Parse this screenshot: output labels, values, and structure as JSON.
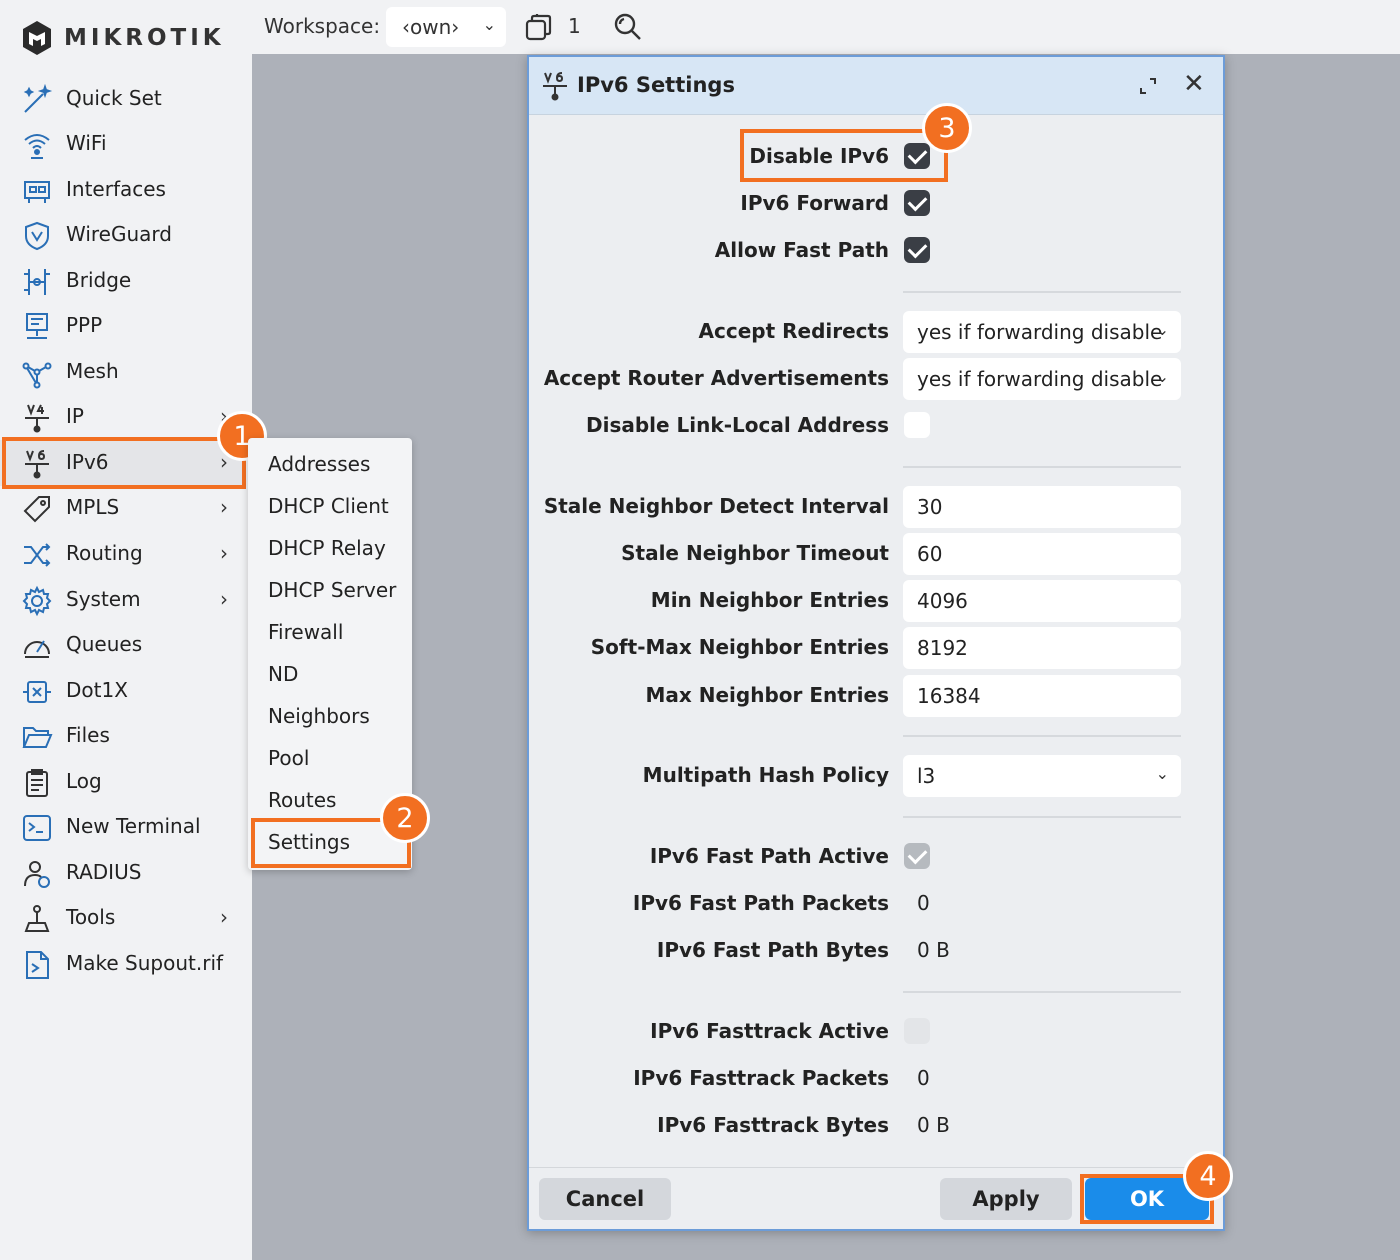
{
  "brand": {
    "name": "MIKROTIK"
  },
  "topbar": {
    "workspace_label": "Workspace:",
    "workspace_value": "‹own›",
    "window_count": "1"
  },
  "sidebar": {
    "items": [
      {
        "label": "Quick Set",
        "icon": "wand-icon",
        "submenu": false
      },
      {
        "label": "WiFi",
        "icon": "wifi-icon",
        "submenu": false
      },
      {
        "label": "Interfaces",
        "icon": "interfaces-icon",
        "submenu": false
      },
      {
        "label": "WireGuard",
        "icon": "shield-icon",
        "submenu": false
      },
      {
        "label": "Bridge",
        "icon": "bridge-icon",
        "submenu": false
      },
      {
        "label": "PPP",
        "icon": "ppp-icon",
        "submenu": false
      },
      {
        "label": "Mesh",
        "icon": "mesh-icon",
        "submenu": false
      },
      {
        "label": "IP",
        "icon": "ipv4-icon",
        "submenu": true
      },
      {
        "label": "IPv6",
        "icon": "ipv6-icon",
        "submenu": true,
        "active": true
      },
      {
        "label": "MPLS",
        "icon": "tag-icon",
        "submenu": true
      },
      {
        "label": "Routing",
        "icon": "routing-icon",
        "submenu": true
      },
      {
        "label": "System",
        "icon": "gear-icon",
        "submenu": true
      },
      {
        "label": "Queues",
        "icon": "gauge-icon",
        "submenu": false
      },
      {
        "label": "Dot1X",
        "icon": "dot1x-icon",
        "submenu": false
      },
      {
        "label": "Files",
        "icon": "folder-icon",
        "submenu": false
      },
      {
        "label": "Log",
        "icon": "log-icon",
        "submenu": false
      },
      {
        "label": "New Terminal",
        "icon": "terminal-icon",
        "submenu": false
      },
      {
        "label": "RADIUS",
        "icon": "radius-icon",
        "submenu": false
      },
      {
        "label": "Tools",
        "icon": "tools-icon",
        "submenu": true
      },
      {
        "label": "Make Supout.rif",
        "icon": "supout-icon",
        "submenu": false
      }
    ]
  },
  "submenu": {
    "items": [
      "Addresses",
      "DHCP Client",
      "DHCP Relay",
      "DHCP Server",
      "Firewall",
      "ND",
      "Neighbors",
      "Pool",
      "Routes",
      "Settings"
    ],
    "selected": "Settings"
  },
  "dialog": {
    "title": "IPv6 Settings",
    "fields": {
      "disable_ipv6": {
        "label": "Disable IPv6",
        "checked": true
      },
      "ipv6_forward": {
        "label": "IPv6 Forward",
        "checked": true
      },
      "allow_fast_path": {
        "label": "Allow Fast Path",
        "checked": true
      },
      "accept_redirects": {
        "label": "Accept Redirects",
        "value": "yes if forwarding disable"
      },
      "accept_router_adv": {
        "label": "Accept Router Advertisements",
        "value": "yes if forwarding disable"
      },
      "disable_link_local": {
        "label": "Disable Link-Local Address",
        "checked": false
      },
      "stale_detect": {
        "label": "Stale Neighbor Detect Interval",
        "value": "30"
      },
      "stale_timeout": {
        "label": "Stale Neighbor Timeout",
        "value": "60"
      },
      "min_entries": {
        "label": "Min Neighbor Entries",
        "value": "4096"
      },
      "softmax_entries": {
        "label": "Soft-Max Neighbor Entries",
        "value": "8192"
      },
      "max_entries": {
        "label": "Max Neighbor Entries",
        "value": "16384"
      },
      "multipath": {
        "label": "Multipath Hash Policy",
        "value": "l3"
      },
      "fp_active": {
        "label": "IPv6 Fast Path Active",
        "checked": true
      },
      "fp_packets": {
        "label": "IPv6 Fast Path Packets",
        "value": "0"
      },
      "fp_bytes": {
        "label": "IPv6 Fast Path Bytes",
        "value": "0 B"
      },
      "ft_active": {
        "label": "IPv6 Fasttrack Active",
        "checked": false
      },
      "ft_packets": {
        "label": "IPv6 Fasttrack Packets",
        "value": "0"
      },
      "ft_bytes": {
        "label": "IPv6 Fasttrack Bytes",
        "value": "0 B"
      }
    },
    "buttons": {
      "cancel": "Cancel",
      "apply": "Apply",
      "ok": "OK"
    }
  },
  "callouts": [
    "1",
    "2",
    "3",
    "4"
  ],
  "colors": {
    "highlight": "#f26f21",
    "ok_button": "#1a8cea",
    "header": "#d7e6f5"
  }
}
